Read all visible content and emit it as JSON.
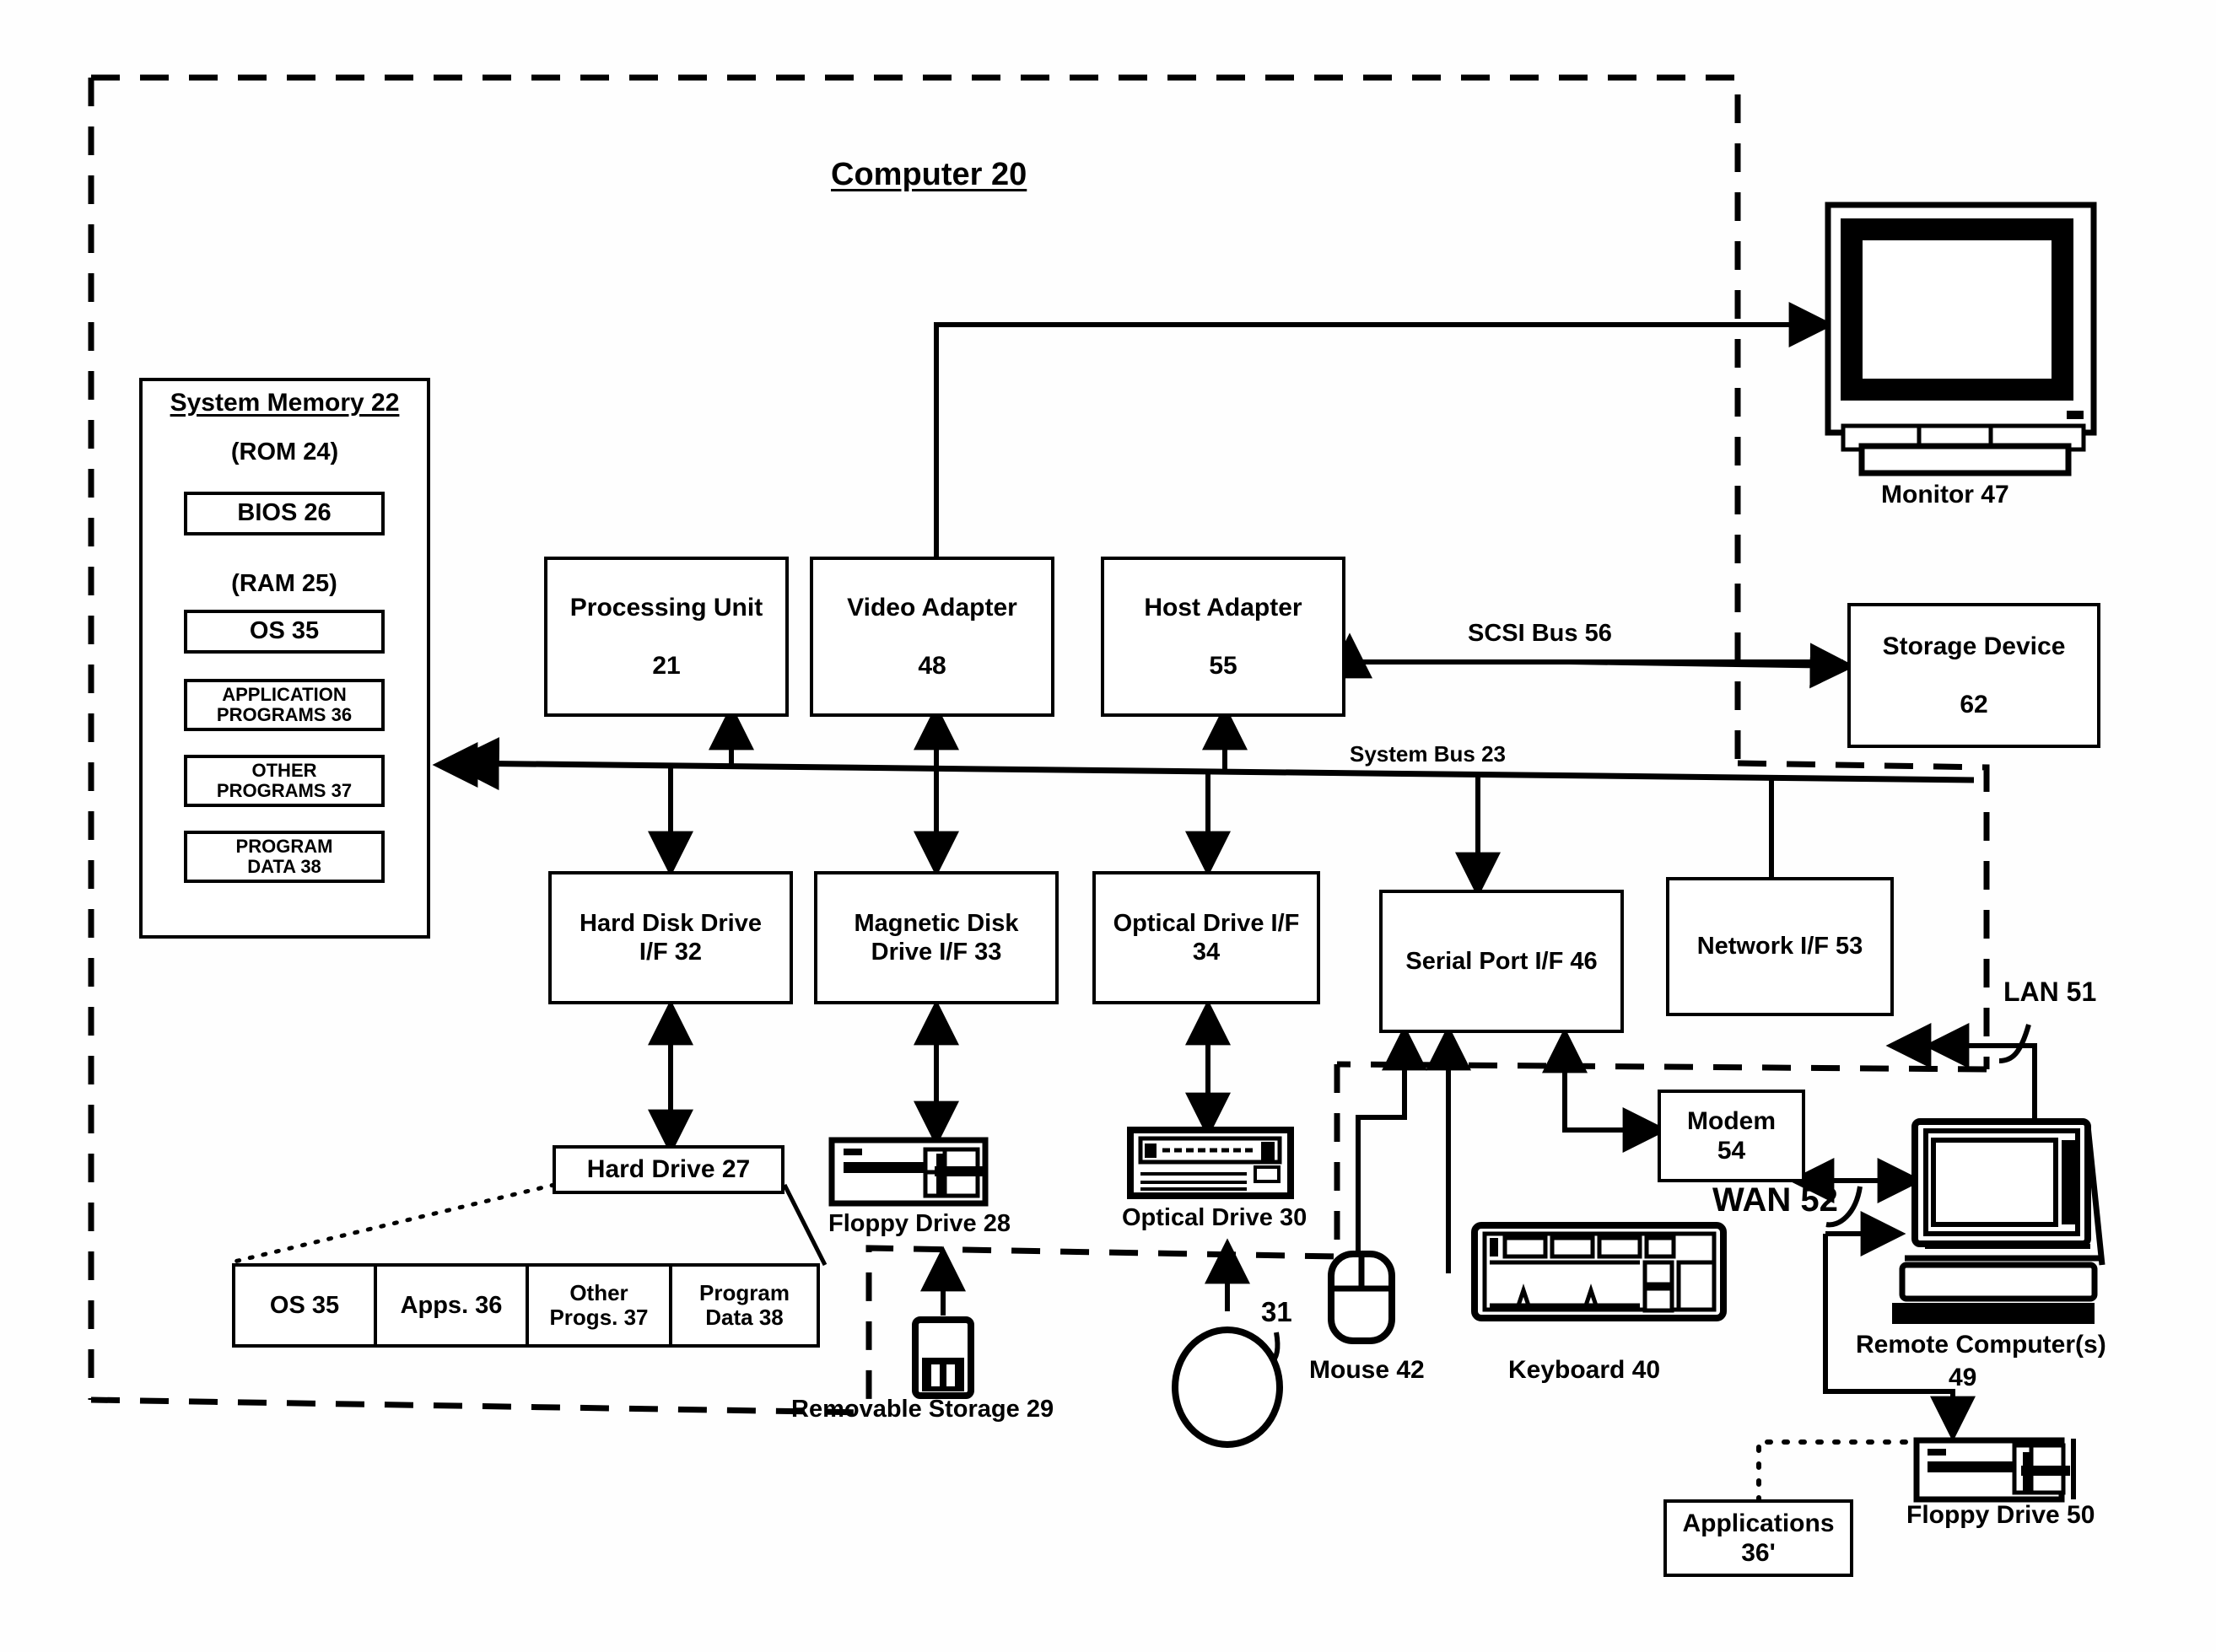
{
  "diagram": {
    "title": "Computer 20",
    "figure_type": "patent-block-diagram"
  },
  "system_memory": {
    "heading": "System Memory 22",
    "rom_label": "(ROM 24)",
    "rom_items": [
      {
        "label": "BIOS 26"
      }
    ],
    "ram_label": "(RAM 25)",
    "ram_items": [
      {
        "label": "OS 35"
      },
      {
        "label": "APPLICATION\nPROGRAMS 36"
      },
      {
        "label": "OTHER\nPROGRAMS 37"
      },
      {
        "label": "PROGRAM\nDATA 38"
      }
    ]
  },
  "adapters": [
    {
      "name": "Processing Unit",
      "ref": "21"
    },
    {
      "name": "Video Adapter",
      "ref": "48"
    },
    {
      "name": "Host Adapter",
      "ref": "55"
    }
  ],
  "interfaces": [
    {
      "line1": "Hard Disk Drive",
      "line2": "I/F 32"
    },
    {
      "line1": "Magnetic Disk",
      "line2": "Drive I/F 33"
    },
    {
      "line1": "Optical Drive I/F",
      "line2": "34"
    },
    {
      "line1": "Serial Port I/F 46",
      "line2": ""
    },
    {
      "line1": "Network I/F 53",
      "line2": ""
    }
  ],
  "buses": {
    "system_bus": "System Bus 23",
    "scsi_bus": "SCSI Bus 56",
    "lan": "LAN 51",
    "wan": "WAN 52"
  },
  "peripherals": {
    "monitor": "Monitor 47",
    "storage_device": {
      "name": "Storage Device",
      "ref": "62"
    },
    "hard_drive": "Hard Drive 27",
    "hard_drive_partitions": [
      {
        "label": "OS 35"
      },
      {
        "label": "Apps. 36"
      },
      {
        "label": "Other\nProgs. 37"
      },
      {
        "label": "Program\nData 38"
      }
    ],
    "floppy_drive": "Floppy Drive 28",
    "removable_storage": "Removable Storage 29",
    "optical_drive": "Optical Drive 30",
    "optical_disc_ref": "31",
    "mouse": "Mouse 42",
    "keyboard": "Keyboard 40",
    "modem": {
      "name": "Modem",
      "ref": "54"
    },
    "remote_computer": {
      "line1": "Remote Computer(s)",
      "line2": "49"
    },
    "remote_floppy": "Floppy Drive 50",
    "remote_applications": {
      "name": "Applications",
      "ref": "36'"
    }
  },
  "colors": {
    "ink": "#000000",
    "paper": "#ffffff"
  }
}
